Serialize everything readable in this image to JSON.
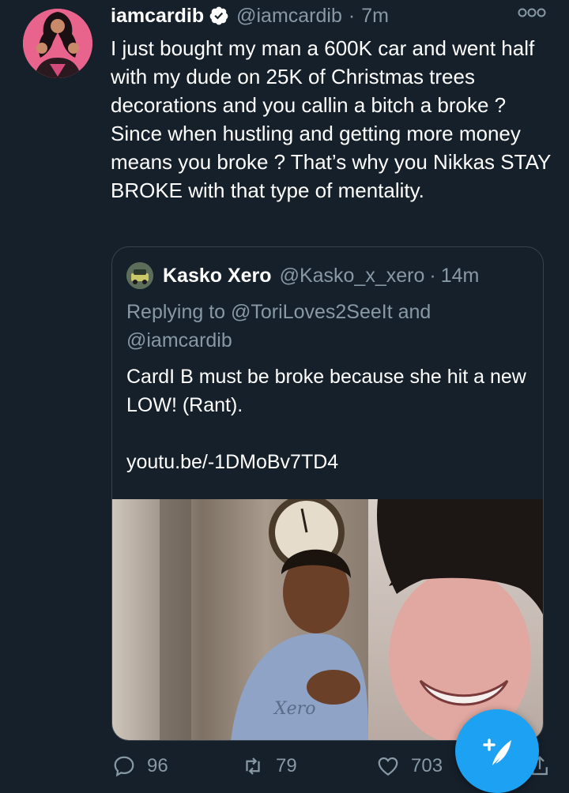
{
  "tweet": {
    "display_name": "iamcardib",
    "handle": "@iamcardib",
    "separator": "·",
    "time": "7m",
    "text": "I just bought my man a 600K car and went half with my dude on 25K of Christmas trees decorations and you callin a bitch a broke ? Since when hustling and getting more money means you broke ? That’s why you Nikkas STAY BROKE with that type of mentality.",
    "verified": true
  },
  "quoted": {
    "display_name": "Kasko Xero",
    "handle": "@Kasko_x_xero",
    "separator": "·",
    "time": "14m",
    "replying_to": "Replying to @ToriLoves2SeeIt and @iamcardib",
    "text": "CardI B must be broke because she hit a new LOW! (Rant).",
    "link": "youtu.be/-1DMoBv7TD4",
    "media_caption": "Xero"
  },
  "actions": {
    "replies": "96",
    "retweets": "79",
    "likes": "703"
  },
  "colors": {
    "background": "#15202b",
    "text": "#ffffff",
    "muted": "#8899a6",
    "border": "#38444d",
    "accent": "#1da1f2"
  },
  "icons": [
    "verified-icon",
    "more-icon",
    "reply-icon",
    "retweet-icon",
    "like-icon",
    "share-icon",
    "compose-icon"
  ]
}
